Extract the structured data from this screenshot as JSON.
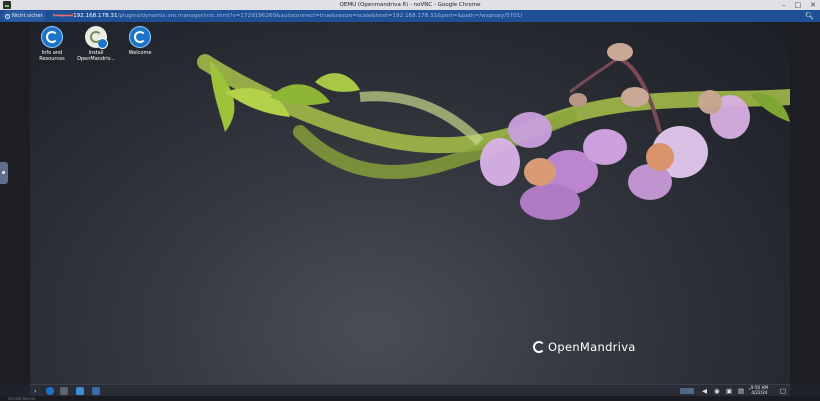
{
  "window": {
    "title": "QEMU (Openmandriva 6) - noVNC - Google Chrome",
    "buttons": {
      "minimize": "–",
      "maximize": "□",
      "close": "✕"
    }
  },
  "addressbar": {
    "security_label": "Nicht sicher",
    "url_scheme": "https://",
    "url_host": "192.168.178.31",
    "url_rest": "/plugins/dynamix.vm.manager/vnc.html?v=1729196260&autoconnect=true&resize=scale&host=192.168.178.31&port=&path=/wsproxy/5701/",
    "zoom_icon": "search-icon"
  },
  "desktop": {
    "icons": [
      {
        "label": "Info and Resources",
        "icon": "openmandriva-icon"
      },
      {
        "label": "Install OpenMandriv...",
        "icon": "installer-icon"
      },
      {
        "label": "Welcome",
        "icon": "openmandriva-icon"
      }
    ],
    "brand": "OpenMandriva",
    "colors": {
      "accent": "#1b74c9",
      "orchid": "#c48ad8",
      "stem": "#a8c24a"
    }
  },
  "taskbar": {
    "clock_time": "9:50 AM",
    "clock_date": "4/22/24"
  },
  "bottom": {
    "label": "Unraid Server"
  }
}
